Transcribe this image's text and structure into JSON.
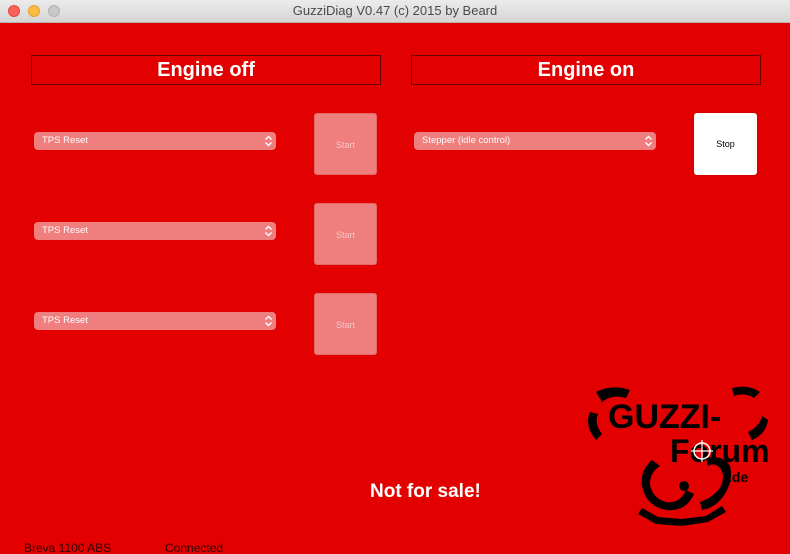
{
  "window": {
    "title": "GuzziDiag V0.47  (c) 2015 by Beard"
  },
  "engine_off": {
    "heading": "Engine off",
    "rows": [
      {
        "select_value": "TPS Reset",
        "button_label": "Start"
      },
      {
        "select_value": "TPS Reset",
        "button_label": "Start"
      },
      {
        "select_value": "TPS Reset",
        "button_label": "Start"
      }
    ]
  },
  "engine_on": {
    "heading": "Engine on",
    "select_value": "Stepper (idle control)",
    "button_label": "Stop"
  },
  "notice": "Not for sale!",
  "logo": {
    "line1": "GUZZI-",
    "line2": "Forum",
    "suffix": ".de"
  },
  "status": {
    "model": "Breva 1100 ABS",
    "connection": "Connected"
  },
  "colors": {
    "background": "#e20000",
    "control_disabled": "#ef7f7f",
    "heading_border": "#6a0000"
  }
}
